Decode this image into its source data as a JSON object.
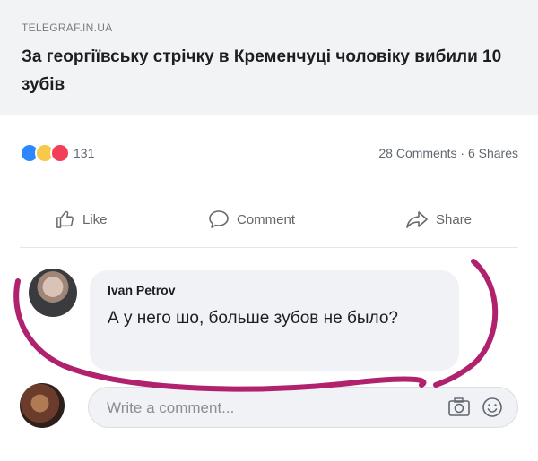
{
  "post": {
    "link_source": "TELEGRAF.IN.UA",
    "link_title": "За георгіївську стрічку в Кременчуці чоловіку вибили 10 зубів",
    "reaction_count": "131",
    "stats": "28 Comments · 6 Shares"
  },
  "actions": {
    "like_label": "Like",
    "comment_label": "Comment",
    "share_label": "Share"
  },
  "comment": {
    "author": "Ivan Petrov",
    "text": "А у него шо, больше зубов не было?"
  },
  "composer": {
    "placeholder": "Write a comment..."
  },
  "colors": {
    "highlight_stroke": "#b0216e",
    "like_blue": "#2d88ff",
    "haha_yellow": "#f7c948",
    "love_red": "#f33e58"
  },
  "icons": [
    "like-icon",
    "comment-icon",
    "share-icon",
    "camera-icon",
    "emoji-icon"
  ]
}
